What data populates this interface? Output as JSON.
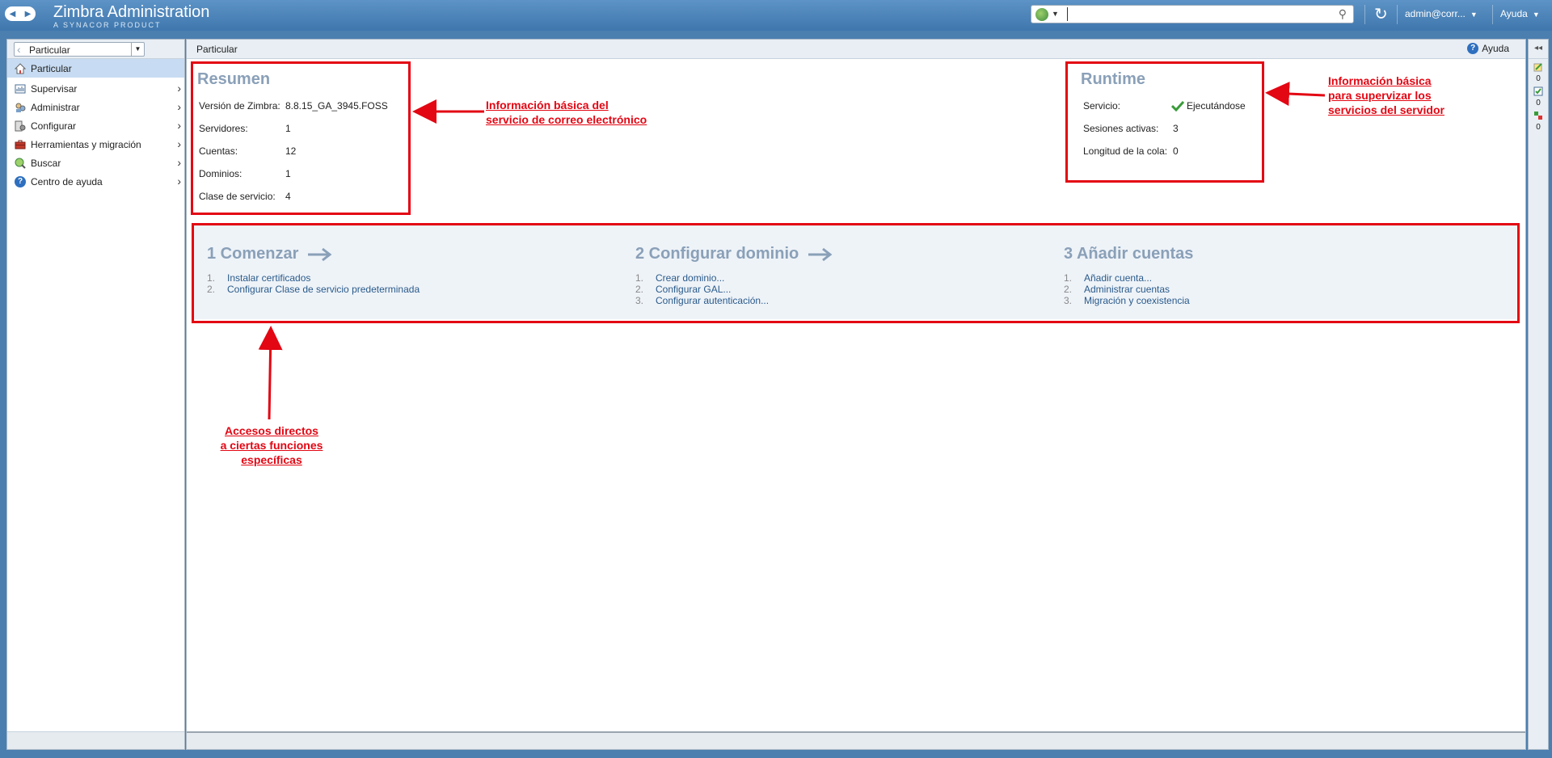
{
  "header": {
    "app_title": "Zimbra Administration",
    "app_subtitle": "A SYNACOR PRODUCT",
    "search_value": "",
    "user": "admin@corr...",
    "help": "Ayuda"
  },
  "sidebar": {
    "selector_value": "Particular",
    "items": [
      {
        "label": "Particular"
      },
      {
        "label": "Supervisar"
      },
      {
        "label": "Administrar"
      },
      {
        "label": "Configurar"
      },
      {
        "label": "Herramientas y migración"
      },
      {
        "label": "Buscar"
      },
      {
        "label": "Centro de ayuda"
      }
    ]
  },
  "main": {
    "breadcrumb": "Particular",
    "help": "Ayuda",
    "summary": {
      "title": "Resumen",
      "rows": [
        {
          "label": "Versión de Zimbra:",
          "value": "8.8.15_GA_3945.FOSS"
        },
        {
          "label": "Servidores:",
          "value": "1"
        },
        {
          "label": "Cuentas:",
          "value": "12"
        },
        {
          "label": "Dominios:",
          "value": "1"
        },
        {
          "label": "Clase de servicio:",
          "value": "4"
        }
      ]
    },
    "runtime": {
      "title": "Runtime",
      "rows": [
        {
          "label": "Servicio:",
          "value": "Ejecutándose"
        },
        {
          "label": "Sesiones activas:",
          "value": "3"
        },
        {
          "label": "Longitud de la cola:",
          "value": "0"
        }
      ]
    },
    "steps": [
      {
        "title": "1 Comenzar",
        "items": [
          {
            "num": "1.",
            "label": "Instalar certificados"
          },
          {
            "num": "2.",
            "label": "Configurar Clase de servicio predeterminada"
          }
        ]
      },
      {
        "title": "2 Configurar dominio",
        "items": [
          {
            "num": "1.",
            "label": "Crear dominio..."
          },
          {
            "num": "2.",
            "label": "Configurar GAL..."
          },
          {
            "num": "3.",
            "label": "Configurar autenticación..."
          }
        ]
      },
      {
        "title": "3 Añadir cuentas",
        "items": [
          {
            "num": "1.",
            "label": "Añadir cuenta..."
          },
          {
            "num": "2.",
            "label": "Administrar cuentas"
          },
          {
            "num": "3.",
            "label": "Migración y coexistencia"
          }
        ]
      }
    ]
  },
  "rightbar": {
    "counts": [
      "0",
      "0",
      "0"
    ]
  },
  "annotations": {
    "summary_note": [
      "Información básica del",
      "servicio de correo electrónico"
    ],
    "runtime_note": [
      "Información básica",
      "para supervizar los",
      "servicios del servidor"
    ],
    "shortcuts_note": [
      "Accesos directos",
      "a ciertas funciones",
      "específicas"
    ]
  },
  "colors": {
    "accent": "#3f77ad",
    "annotation": "#e30613",
    "section_title": "#8aa0b8",
    "link": "#2a5a8a",
    "active_nav": "#c7dcf2"
  },
  "icons": [
    "back-icon",
    "forward-icon",
    "search-scope-icon",
    "magnifier-icon",
    "refresh-icon",
    "home-icon",
    "monitor-icon",
    "admin-icon",
    "configure-icon",
    "toolbox-icon",
    "search-icon",
    "help-icon",
    "check-icon",
    "arrow-right-icon",
    "collapse-icon",
    "notes-icon"
  ]
}
